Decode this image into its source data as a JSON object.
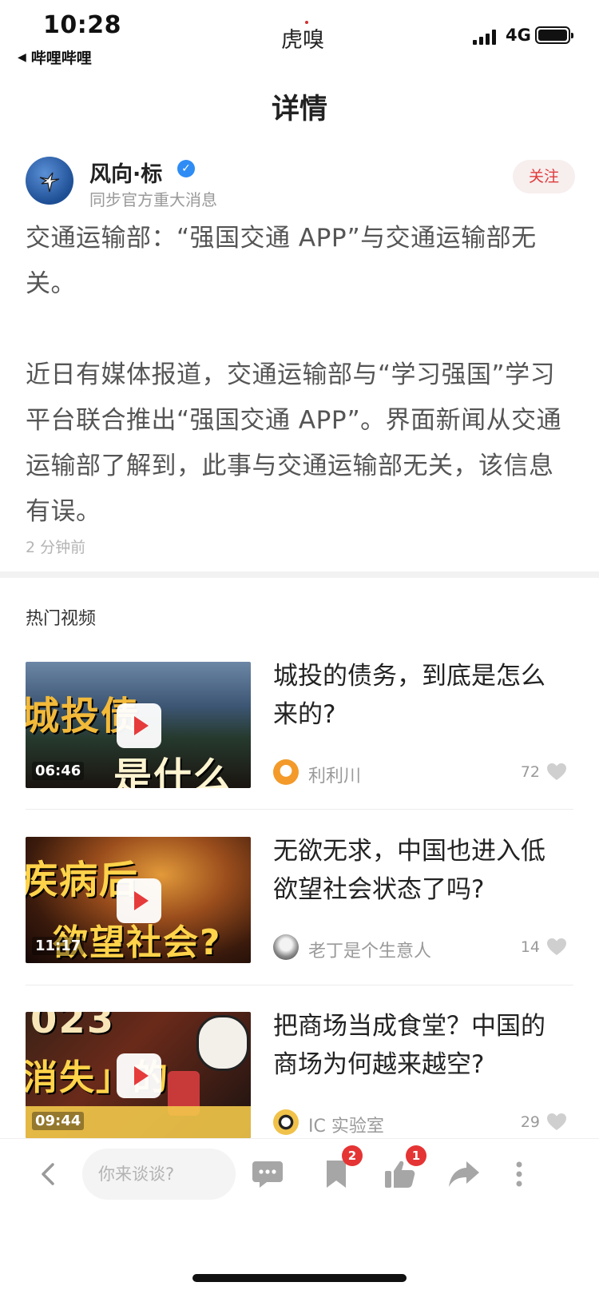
{
  "status_bar": {
    "time": "10:28",
    "back_app": "哔哩哔哩",
    "brand": "虎嗅",
    "network": "4G"
  },
  "header": {
    "title": "详情"
  },
  "author": {
    "name": "风向·标",
    "subtitle": "同步官方重大消息",
    "follow_label": "关注",
    "verified_icon": "check-icon"
  },
  "article": {
    "headline": "交通运输部：“强国交通 APP”与交通运输部无关。",
    "body": "近日有媒体报道，交通运输部与“学习强国”学习平台联合推出“强国交通 APP”。界面新闻从交通运输部了解到，此事与交通运输部无关，该信息有误。",
    "time_ago": "2 分钟前"
  },
  "hot_videos": {
    "section_title": "热门视频",
    "items": [
      {
        "title": "城投的债务，到底是怎么来的?",
        "duration": "06:46",
        "author": "利利川",
        "likes": "72",
        "thumb_text_1": "城投债",
        "thumb_text_2": "是什么"
      },
      {
        "title": "无欲无求，中国也进入低欲望社会状态了吗?",
        "duration": "11:17",
        "author": "老丁是个生意人",
        "likes": "14",
        "thumb_text_1": "疾病后",
        "thumb_text_2": "欲望社会?"
      },
      {
        "title": "把商场当成食堂？中国的商场为何越来越空?",
        "duration": "09:44",
        "author": "IC 实验室",
        "likes": "29",
        "thumb_text_1": "023",
        "thumb_text_2": "消失」的"
      }
    ]
  },
  "bottom_bar": {
    "comment_placeholder": "你来谈谈?",
    "bookmark_badge": "2",
    "like_badge": "1"
  },
  "colors": {
    "accent_red": "#e03a3a",
    "verified_blue": "#2f8cf5",
    "thumb_yellow": "#f4c23c"
  }
}
